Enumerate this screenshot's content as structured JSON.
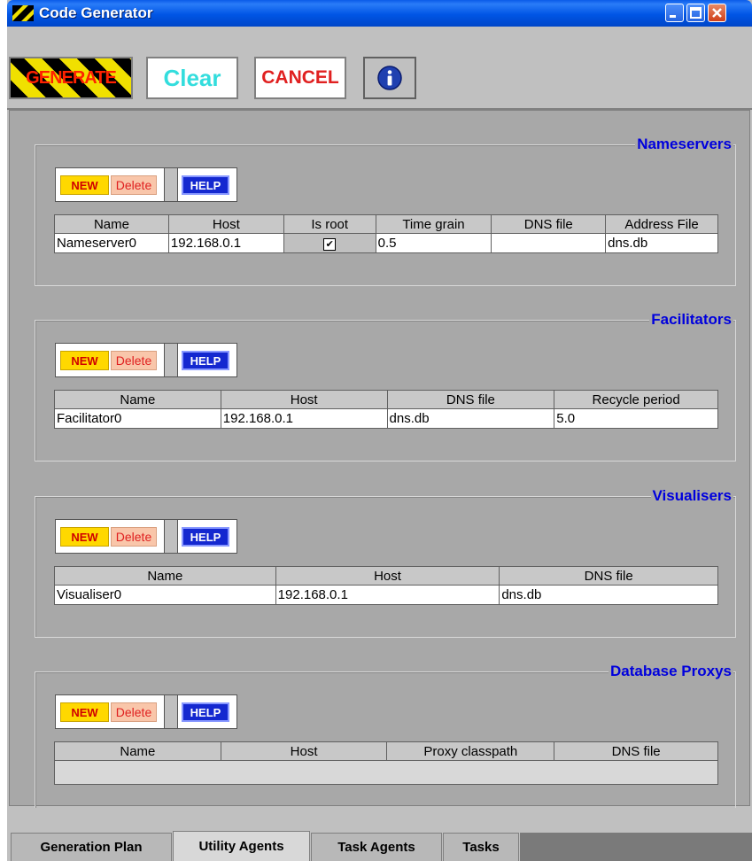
{
  "window": {
    "title": "Code Generator"
  },
  "toolbar": {
    "generate_label": "GENERATE",
    "clear_label": "Clear",
    "cancel_label": "CANCEL"
  },
  "panel_buttons": {
    "new_label": "NEW",
    "delete_label": "Delete",
    "help_label": "HELP"
  },
  "nameservers": {
    "title": "Nameservers",
    "columns": [
      "Name",
      "Host",
      "Is root",
      "Time grain",
      "DNS file",
      "Address File"
    ],
    "rows": [
      {
        "name": "Nameserver0",
        "host": "192.168.0.1",
        "is_root": "✔",
        "time_grain": "0.5",
        "dns_file": "",
        "address_file": "dns.db"
      }
    ]
  },
  "facilitators": {
    "title": "Facilitators",
    "columns": [
      "Name",
      "Host",
      "DNS file",
      "Recycle period"
    ],
    "rows": [
      {
        "name": "Facilitator0",
        "host": "192.168.0.1",
        "dns_file": "dns.db",
        "recycle_period": "5.0"
      }
    ]
  },
  "visualisers": {
    "title": "Visualisers",
    "columns": [
      "Name",
      "Host",
      "DNS file"
    ],
    "rows": [
      {
        "name": "Visualiser0",
        "host": "192.168.0.1",
        "dns_file": "dns.db"
      }
    ]
  },
  "database_proxys": {
    "title": "Database Proxys",
    "columns": [
      "Name",
      "Host",
      "Proxy classpath",
      "DNS file"
    ],
    "rows": []
  },
  "tabs": [
    {
      "label": "Generation Plan"
    },
    {
      "label": "Utility Agents"
    },
    {
      "label": "Task Agents"
    },
    {
      "label": "Tasks"
    }
  ],
  "colors": {
    "title_bar": "#0055e5",
    "panel_title": "#0000dd",
    "generate_text": "#ff2200",
    "clear_text": "#33dddd",
    "cancel_text": "#e02020"
  }
}
